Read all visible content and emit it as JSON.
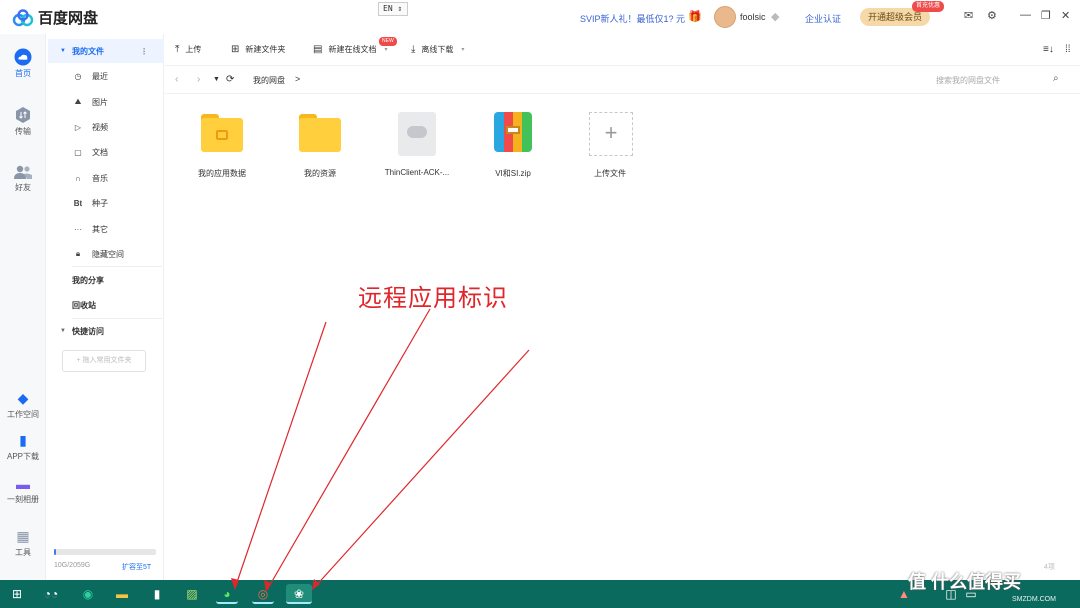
{
  "app": {
    "name": "百度网盘",
    "brand_color": "#1b6cf2"
  },
  "titlebar": {
    "ime_indicator": "EN",
    "svip_promo": "SVIP新人礼！最低仅1? 元",
    "username": "foolsic",
    "enterprise_verify": "企业认证",
    "upgrade_button": "开通超级会员",
    "upgrade_badge": "首充优惠",
    "icons": [
      "mail-icon",
      "settings-icon",
      "minimize-icon",
      "restore-icon",
      "close-icon"
    ]
  },
  "rail": {
    "items": [
      {
        "label": "首页",
        "icon": "cloud-icon",
        "active": true
      },
      {
        "label": "传输",
        "icon": "transfer-icon",
        "active": false
      },
      {
        "label": "好友",
        "icon": "friends-icon",
        "active": false
      },
      {
        "label": "工作空间",
        "icon": "workspace-icon",
        "active": false
      },
      {
        "label": "APP下载",
        "icon": "phone-icon",
        "active": false
      },
      {
        "label": "一刻相册",
        "icon": "album-icon",
        "active": false
      },
      {
        "label": "工具",
        "icon": "tools-icon",
        "active": false
      }
    ]
  },
  "sidebar": {
    "my_files": "我的文件",
    "categories": [
      {
        "label": "最近",
        "icon": "clock-icon"
      },
      {
        "label": "图片",
        "icon": "image-icon"
      },
      {
        "label": "视频",
        "icon": "video-icon"
      },
      {
        "label": "文档",
        "icon": "document-icon"
      },
      {
        "label": "音乐",
        "icon": "music-icon"
      },
      {
        "label": "种子",
        "icon": "torrent-icon"
      },
      {
        "label": "其它",
        "icon": "more-icon"
      },
      {
        "label": "隐藏空间",
        "icon": "lock-icon"
      }
    ],
    "my_share": "我的分享",
    "recycle_bin": "回收站",
    "quick_access": "快捷访问",
    "pin_placeholder": "+ 拖入常用文件夹",
    "quota_text": "10G/2059G",
    "quota_fraction": 0.005,
    "expand_link": "扩容至5T"
  },
  "toolbar": {
    "upload": "上传",
    "new_folder": "新建文件夹",
    "new_online_doc": "新建在线文档",
    "new_badge": "NEW",
    "offline_download": "离线下载"
  },
  "address": {
    "breadcrumb": "我的网盘",
    "separator": ">",
    "search_placeholder": "搜索我的网盘文件"
  },
  "files": [
    {
      "name": "我的应用数据",
      "type": "folder-app"
    },
    {
      "name": "我的资源",
      "type": "folder"
    },
    {
      "name": "ThinClient-ACK-...",
      "type": "cloud-doc"
    },
    {
      "name": "VI和SI.zip",
      "type": "zip"
    },
    {
      "name": "上传文件",
      "type": "upload"
    }
  ],
  "status": {
    "item_count": "4项"
  },
  "annotation": {
    "label": "远程应用标识",
    "color": "#e0262b"
  },
  "taskbar": {
    "color": "#0b6a5e",
    "apps": [
      "windows-start-icon",
      "task-view-icon",
      "edge-icon",
      "file-explorer-icon",
      "terminal-icon",
      "notepad-icon",
      "wechat-remote-icon",
      "chrome-remote-icon",
      "baidu-netdisk-remote-icon"
    ]
  },
  "watermark": {
    "text": "值 什么值得买",
    "sub": "SMZDM.COM"
  }
}
